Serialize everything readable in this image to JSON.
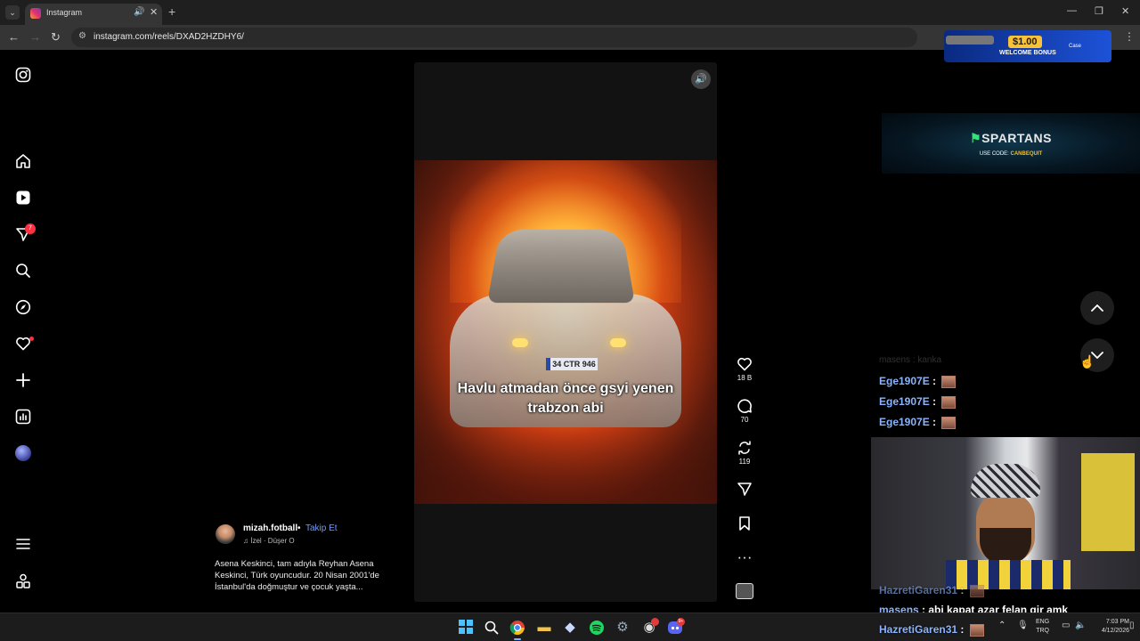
{
  "browser": {
    "tab_title": "Instagram",
    "url": "instagram.com/reels/DXAD2HZDHY6/"
  },
  "sidebar": {
    "notification_count": "7"
  },
  "reel": {
    "plate_text": "34 CTR 946",
    "overlay_caption_line1": "Havlu atmadan önce gsyi yenen",
    "overlay_caption_line2": "trabzon abi"
  },
  "actions": {
    "likes": "18 B",
    "comments": "70",
    "reposts": "119"
  },
  "post": {
    "username": "mizah.fotball",
    "follow_separator": "•",
    "follow_label": "Takip Et",
    "audio": "İzel · Düşer O",
    "caption": "Asena Keskinci, tam adıyla Reyhan Asena Keskinci, Türk oyuncudur. 20 Nisan 2001'de İstanbul'da doğmuştur ve çocuk yaşta..."
  },
  "promo": {
    "amount": "$1.00",
    "bonus": "WELCOME BONUS",
    "brand": "Case"
  },
  "spartans": {
    "name": "SPARTANS",
    "code_label": "USE CODE:",
    "code": "CANBEQUIT"
  },
  "chat": {
    "faded_line": "masens : kanka",
    "messages": [
      {
        "user": "Ege1907E",
        "text": ""
      },
      {
        "user": "Ege1907E",
        "text": ""
      },
      {
        "user": "Ege1907E",
        "text": ""
      },
      {
        "user": "HazretiGaren31",
        "text": ""
      },
      {
        "user": "masens",
        "text": "abi kapat azar felan gir amk"
      },
      {
        "user": "HazretiGaren31",
        "text": ""
      }
    ]
  },
  "taskbar": {
    "lang_line1": "ENG",
    "lang_line2": "TRQ",
    "time": "7:03 PM",
    "date": "4/12/2026",
    "discord_badge": "9+"
  },
  "colors": {
    "accent_link": "#6d9cff",
    "badge_red": "#ff3040",
    "spartans_green": "#36e07a"
  }
}
